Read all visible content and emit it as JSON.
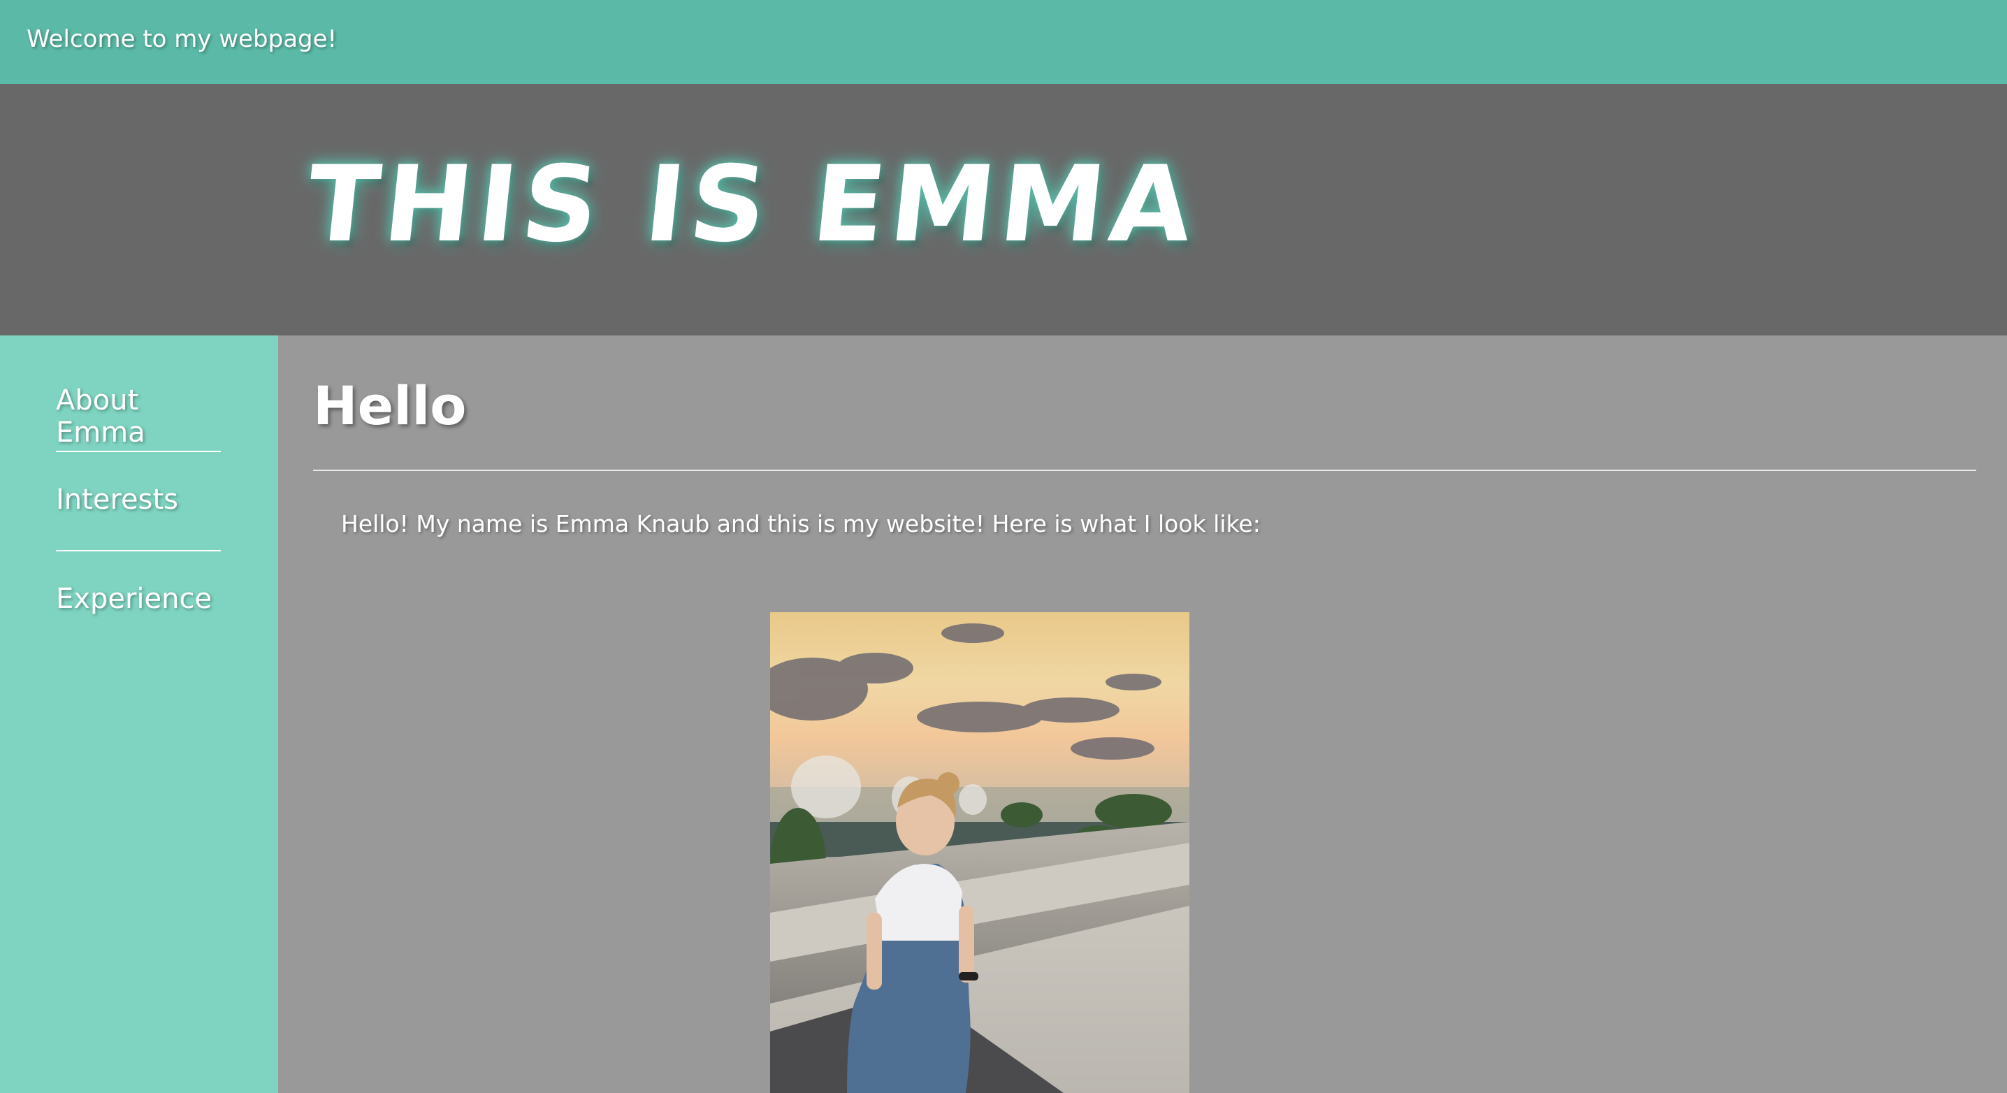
{
  "topbar": {
    "text": "Welcome to my webpage!"
  },
  "header": {
    "title": "THIS IS EMMA"
  },
  "sidebar": {
    "items": [
      {
        "label": "About Emma"
      },
      {
        "label": "Interests"
      },
      {
        "label": "Experience"
      }
    ]
  },
  "main": {
    "heading": "Hello",
    "intro": "Hello! My name is Emma Knaub and this is my website! Here is what I look like:"
  },
  "colors": {
    "topbar": "#5bbaa7",
    "header": "#686868",
    "sidebar": "#7ed4c1",
    "content": "#999999",
    "text": "#ffffff"
  }
}
